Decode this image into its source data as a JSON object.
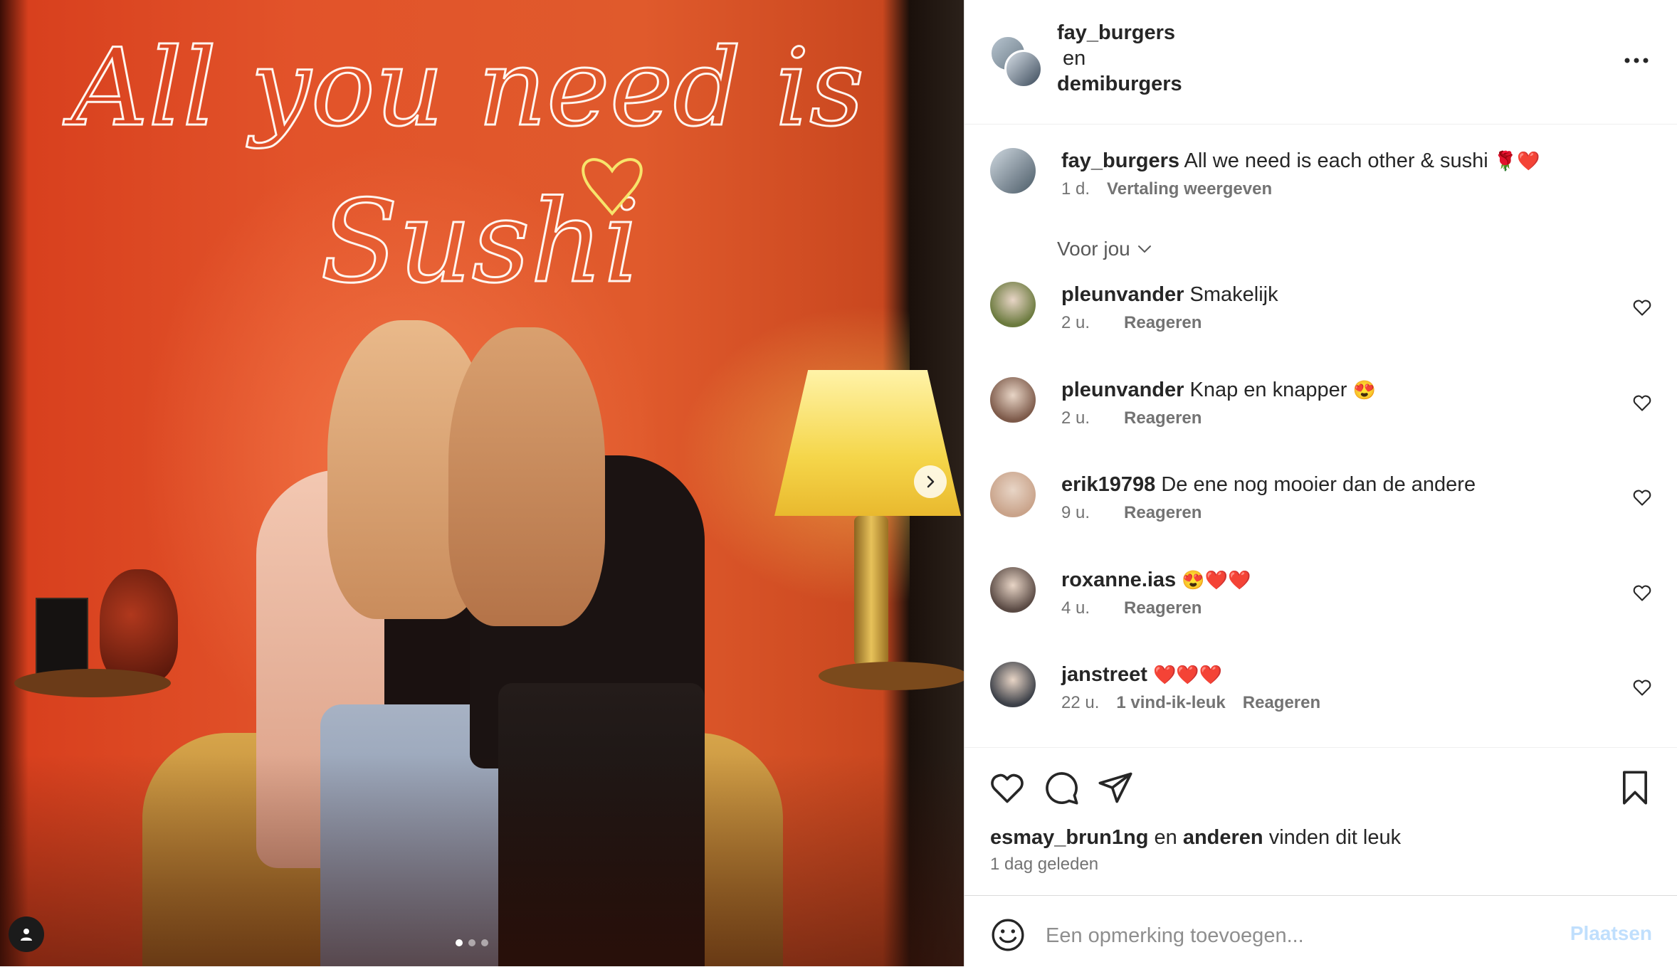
{
  "photo": {
    "neon_line1": "All you need is",
    "neon_line2": "Sushi",
    "carousel": {
      "current": 1,
      "total": 3
    }
  },
  "header": {
    "user1": "fay_burgers",
    "conjunction": "en",
    "user2": "demiburgers"
  },
  "caption": {
    "user": "fay_burgers",
    "text": "All we need is each other & sushi",
    "emoji": "🌹❤️",
    "time": "1 d.",
    "translate": "Vertaling weergeven"
  },
  "filter": {
    "label": "Voor jou"
  },
  "comments": [
    {
      "user": "pleunvander",
      "text": "Smakelijk",
      "emoji": "",
      "time": "2 u.",
      "likes": "",
      "reply": "Reageren",
      "avatar_color": "#6b7a3e"
    },
    {
      "user": "pleunvander",
      "text": "Knap en knapper",
      "emoji": "😍",
      "time": "2 u.",
      "likes": "",
      "reply": "Reageren",
      "avatar_color": "#7d5a4a"
    },
    {
      "user": "erik19798",
      "text": "De ene nog mooier dan de andere",
      "emoji": "",
      "time": "9 u.",
      "likes": "",
      "reply": "Reageren",
      "avatar_color": "#c9a38a"
    },
    {
      "user": "roxanne.ias",
      "text": "",
      "emoji": "😍❤️❤️",
      "time": "4 u.",
      "likes": "",
      "reply": "Reageren",
      "avatar_color": "#5a4a44"
    },
    {
      "user": "janstreet",
      "text": "",
      "emoji": "❤️❤️❤️",
      "time": "22 u.",
      "likes": "1 vind-ik-leuk",
      "reply": "Reageren",
      "avatar_color": "#3c4048"
    }
  ],
  "likes": {
    "user": "esmay_brun1ng",
    "connector": "en",
    "others": "anderen",
    "suffix": "vinden dit leuk",
    "date": "1 dag geleden"
  },
  "comment_input": {
    "placeholder": "Een opmerking toevoegen...",
    "post_label": "Plaatsen"
  },
  "icons": {
    "more": "more-horizontal-icon",
    "heart": "heart-icon",
    "comment": "comment-icon",
    "share": "share-icon",
    "save": "bookmark-icon",
    "emoji": "emoji-icon",
    "next": "chevron-right-icon",
    "tag": "user-tag-icon"
  }
}
